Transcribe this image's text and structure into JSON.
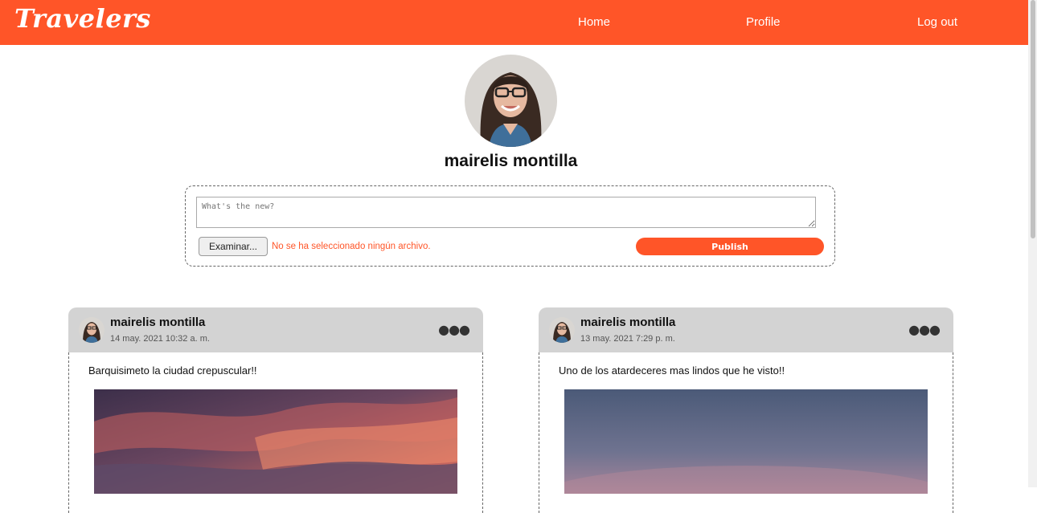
{
  "header": {
    "brand": "Travelers",
    "nav": [
      {
        "label": "Home"
      },
      {
        "label": "Profile"
      },
      {
        "label": "Log out"
      }
    ],
    "color": "#ff5528"
  },
  "profile": {
    "name": "mairelis montilla"
  },
  "composer": {
    "placeholder": "What's the new?",
    "file_button": "Examinar...",
    "file_status": "No se ha seleccionado ningún archivo.",
    "publish_label": "Publish"
  },
  "posts": [
    {
      "author": "mairelis montilla",
      "date": "14 may. 2021 10:32 a. m.",
      "text": "Barquisimeto la ciudad crepuscular!!",
      "photo": "sunset-clouds-photo"
    },
    {
      "author": "mairelis montilla",
      "date": "13 may. 2021 7:29 p. m.",
      "text": "Uno de los atardeceres mas lindos que he visto!!",
      "photo": "dusk-sky-photo"
    }
  ],
  "icons": {
    "post_menu": "more-horizontal-icon"
  }
}
